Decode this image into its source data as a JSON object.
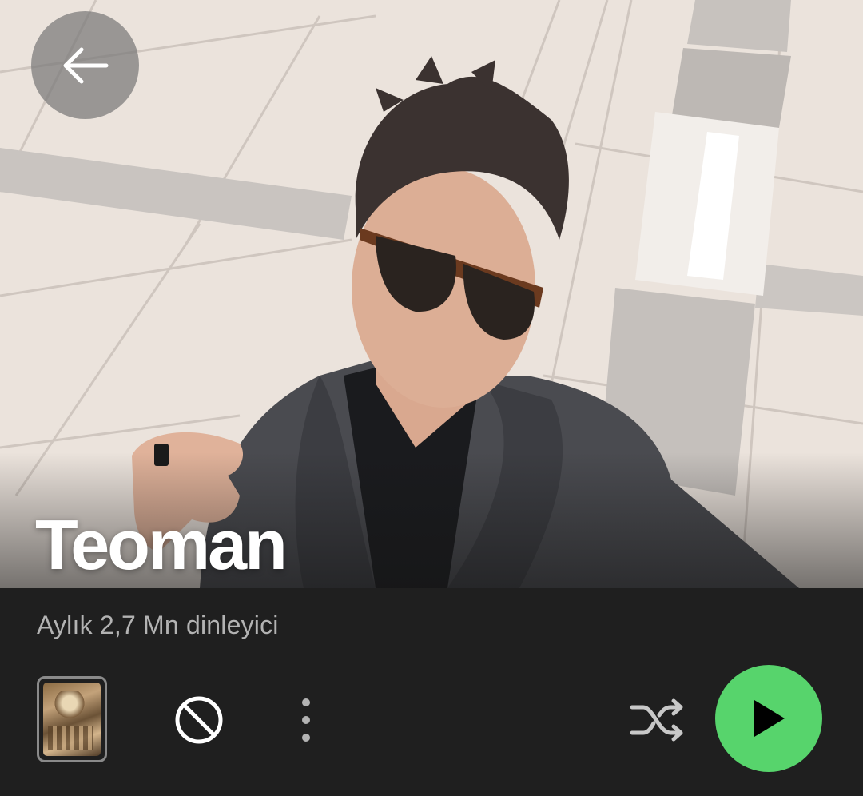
{
  "artist": {
    "name": "Teoman",
    "monthly_listeners": "Aylık 2,7 Mn dinleyici"
  },
  "icons": {
    "back": "arrow-left-icon",
    "block": "block-icon",
    "more": "more-vertical-icon",
    "shuffle": "shuffle-icon",
    "play": "play-icon"
  },
  "colors": {
    "background": "#1f1f1f",
    "accent_green": "#57d46c",
    "secondary_text": "#b3b3b3"
  }
}
